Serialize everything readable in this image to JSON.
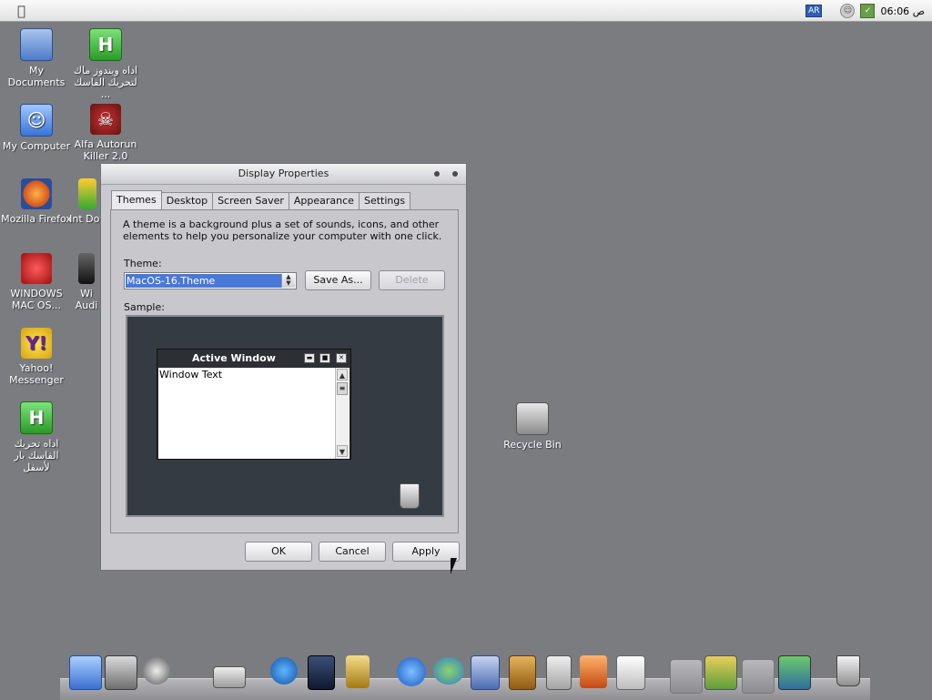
{
  "menubar": {
    "lang_badge": "AR",
    "clock": "06:06 ص"
  },
  "desktop": {
    "icons": [
      {
        "label": "My Documents",
        "icon": "folder-documents-icon"
      },
      {
        "label": "اداه ويندوز ماك لتحريك الفاسك ...",
        "icon": "h-app-icon"
      },
      {
        "label": "My Computer",
        "icon": "mac-finder-icon"
      },
      {
        "label": "Alfa Autorun Killer 2.0",
        "icon": "virus-killer-icon"
      },
      {
        "label": "Mozilla Firefox",
        "icon": "firefox-icon"
      },
      {
        "label": "Int Dov",
        "icon": "download-icon"
      },
      {
        "label": "WINDOWS MAC OS...",
        "icon": "virus-icon"
      },
      {
        "label": "Wi Audi",
        "icon": "audio-icon"
      },
      {
        "label": "Yahoo! Messenger",
        "icon": "yahoo-messenger-icon"
      },
      {
        "label": "اداه تحريك الفاسك بار لأسفل",
        "icon": "h-app-icon"
      },
      {
        "label": "Recycle Bin",
        "icon": "recycle-bin-icon"
      }
    ]
  },
  "dialog": {
    "title": "Display Properties",
    "tabs": [
      "Themes",
      "Desktop",
      "Screen Saver",
      "Appearance",
      "Settings"
    ],
    "description": "A theme is a background plus a set of sounds, icons, and other elements to help you personalize your computer with one click.",
    "theme_label": "Theme:",
    "theme_value": "MacOS-16.Theme",
    "save_as_label": "Save As...",
    "delete_label": "Delete",
    "sample_label": "Sample:",
    "sample_window": {
      "title": "Active Window",
      "text": "Window Text"
    },
    "ok_label": "OK",
    "cancel_label": "Cancel",
    "apply_label": "Apply"
  },
  "dock": {
    "items": [
      "finder-icon",
      "system-preferences-icon",
      "power-icon",
      "drive-icon",
      "media-player-icon",
      "video-icon",
      "winamp-icon",
      "internet-explorer-icon",
      "msn-messenger-icon",
      "mail-icon",
      "address-book-icon",
      "calculator-icon",
      "applications-icon",
      "text-editor-icon",
      "stack-icon",
      "colors-icon",
      "stack-icon",
      "downloads-icon",
      "trash-icon"
    ]
  }
}
